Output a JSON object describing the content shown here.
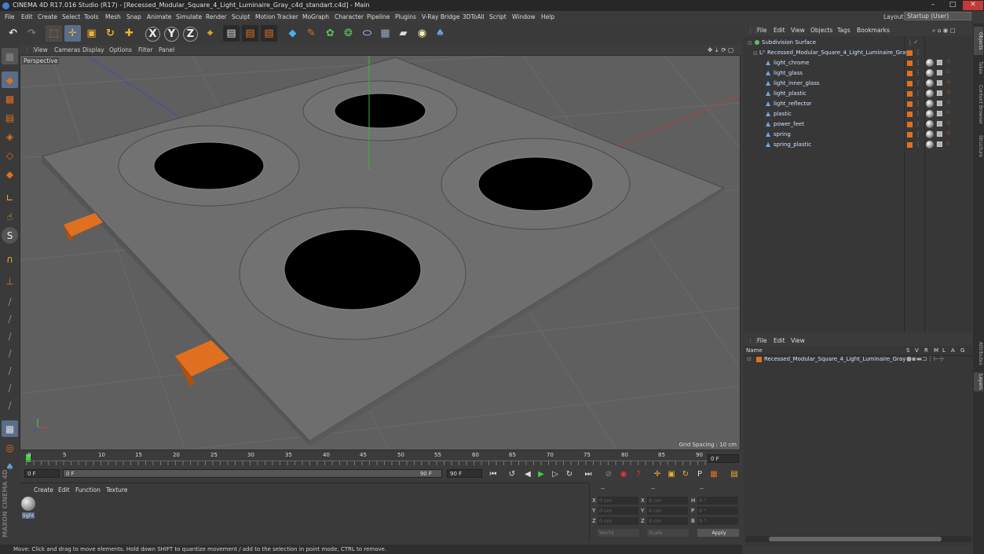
{
  "title_bar": {
    "text": "CINEMA 4D R17.016 Studio (R17) - [Recessed_Modular_Square_4_Light_Luminaire_Gray_c4d_standart.c4d] - Main"
  },
  "menu": [
    "File",
    "Edit",
    "Create",
    "Select",
    "Tools",
    "Mesh",
    "Snap",
    "Animate",
    "Simulate",
    "Render",
    "Sculpt",
    "Motion Tracker",
    "MoGraph",
    "Character",
    "Pipeline",
    "Plugins",
    "V-Ray Bridge",
    "3DToAll",
    "Script",
    "Window",
    "Help"
  ],
  "layout": {
    "label": "Layout:",
    "value": "Startup (User)"
  },
  "toolbar_letters": {
    "x": "X",
    "y": "Y",
    "z": "Z"
  },
  "viewport": {
    "menu": [
      "View",
      "Cameras",
      "Display",
      "Options",
      "Filter",
      "Panel"
    ],
    "label": "Perspective",
    "grid_spacing": "Grid Spacing : 10 cm"
  },
  "timeline": {
    "ticks": [
      "0",
      "5",
      "10",
      "15",
      "20",
      "25",
      "30",
      "35",
      "40",
      "45",
      "50",
      "55",
      "60",
      "65",
      "70",
      "75",
      "80",
      "85",
      "90"
    ],
    "current_frame": "0 F",
    "start_field": "0 F",
    "range_start": "0 F",
    "range_end": "90 F",
    "end_field": "90 F"
  },
  "material_panel": {
    "menu": [
      "Create",
      "Edit",
      "Function",
      "Texture"
    ],
    "material_name": "light"
  },
  "coords": {
    "rows": [
      {
        "a": "X",
        "av": "0 cm",
        "b": "X",
        "bv": "0 cm",
        "c": "H",
        "cv": "0 °"
      },
      {
        "a": "Y",
        "av": "0 cm",
        "b": "Y",
        "bv": "0 cm",
        "c": "P",
        "cv": "0 °"
      },
      {
        "a": "Z",
        "av": "0 cm",
        "b": "Z",
        "bv": "0 cm",
        "c": "B",
        "cv": "0 °"
      }
    ],
    "world": "World",
    "scale": "Scale",
    "apply": "Apply",
    "header_left": "--",
    "header_mid": "--",
    "header_right": "--"
  },
  "status": "Move: Click and drag to move elements. Hold down SHIFT to quantize movement / add to the selection in point mode, CTRL to remove.",
  "object_manager": {
    "menu": [
      "File",
      "Edit",
      "View",
      "Objects",
      "Tags",
      "Bookmarks"
    ],
    "root": "Subdivision Surface",
    "group": "Recessed_Modular_Square_4_Light_Luminaire_Gray",
    "children": [
      "light_chrome",
      "light_glass",
      "light_inner_glass",
      "light_plastic",
      "light_reflector",
      "plastic",
      "power_feet",
      "spring",
      "spring_plastic"
    ]
  },
  "attributes": {
    "menu": [
      "File",
      "Edit",
      "View"
    ],
    "name_header": "Name",
    "cols": [
      "S",
      "V",
      "R",
      "M",
      "L",
      "A",
      "G"
    ],
    "row": "Recessed_Modular_Square_4_Light_Luminaire_Gray"
  },
  "side_tabs": [
    "Objects",
    "Takes",
    "Content Browser",
    "Structure"
  ],
  "side_tabs_lower": [
    "Attributes",
    "Layers"
  ],
  "brand": "MAXON CINEMA 4D",
  "colors": {
    "accent": "#e07020",
    "select_blue": "#3b7fd4",
    "viewport_bg": "#5f5f5f"
  }
}
